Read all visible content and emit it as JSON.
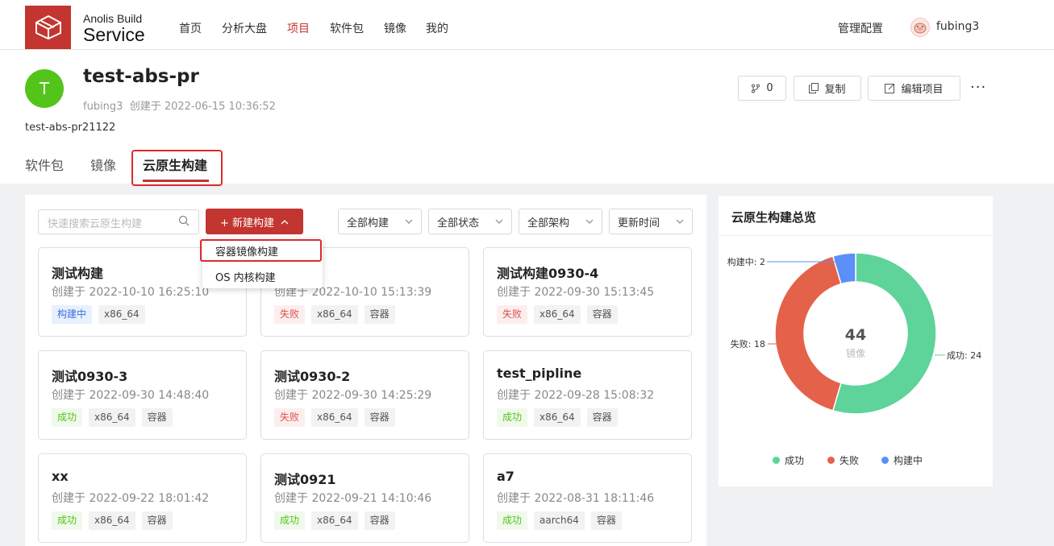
{
  "brand": {
    "line1": "Anolis Build",
    "line2": "Service"
  },
  "nav": [
    "首页",
    "分析大盘",
    "项目",
    "软件包",
    "镜像",
    "我的"
  ],
  "nav_active": "项目",
  "admin": "管理配置",
  "user": "fubing3",
  "project": {
    "avatar_letter": "T",
    "title": "test-abs-pr",
    "meta": "fubing3  创建于 2022-06-15 10:36:52",
    "desc": "test-abs-pr21122",
    "fork_count": "0",
    "copy_label": "复制",
    "edit_label": "编辑项目",
    "more": "···"
  },
  "tabs": [
    "软件包",
    "镜像",
    "云原生构建"
  ],
  "active_tab": "云原生构建",
  "toolbar": {
    "search_placeholder": "快速搜索云原生构建",
    "new_build": "+ 新建构建",
    "filters": [
      "全部构建",
      "全部状态",
      "全部架构",
      "更新时间"
    ]
  },
  "dropdown": [
    "容器镜像构建",
    "OS 内核构建"
  ],
  "cards": [
    {
      "title": "测试构建",
      "date": "创建于 2022-10-10 16:25:10",
      "tags": [
        {
          "t": "构建中",
          "k": "run"
        },
        {
          "t": "x86_64",
          "k": ""
        }
      ]
    },
    {
      "title": "",
      "date": "创建于 2022-10-10 15:13:39",
      "tags": [
        {
          "t": "失败",
          "k": "fail"
        },
        {
          "t": "x86_64",
          "k": ""
        },
        {
          "t": "容器",
          "k": ""
        }
      ]
    },
    {
      "title": "测试构建0930-4",
      "date": "创建于 2022-09-30 15:13:45",
      "tags": [
        {
          "t": "失败",
          "k": "fail"
        },
        {
          "t": "x86_64",
          "k": ""
        },
        {
          "t": "容器",
          "k": ""
        }
      ]
    },
    {
      "title": "测试0930-3",
      "date": "创建于 2022-09-30 14:48:40",
      "tags": [
        {
          "t": "成功",
          "k": "ok"
        },
        {
          "t": "x86_64",
          "k": ""
        },
        {
          "t": "容器",
          "k": ""
        }
      ]
    },
    {
      "title": "测试0930-2",
      "date": "创建于 2022-09-30 14:25:29",
      "tags": [
        {
          "t": "失败",
          "k": "fail"
        },
        {
          "t": "x86_64",
          "k": ""
        },
        {
          "t": "容器",
          "k": ""
        }
      ]
    },
    {
      "title": "test_pipline",
      "date": "创建于 2022-09-28 15:08:32",
      "tags": [
        {
          "t": "成功",
          "k": "ok"
        },
        {
          "t": "x86_64",
          "k": ""
        },
        {
          "t": "容器",
          "k": ""
        }
      ]
    },
    {
      "title": "xx",
      "date": "创建于 2022-09-22 18:01:42",
      "tags": [
        {
          "t": "成功",
          "k": "ok"
        },
        {
          "t": "x86_64",
          "k": ""
        },
        {
          "t": "容器",
          "k": ""
        }
      ]
    },
    {
      "title": "测试0921",
      "date": "创建于 2022-09-21 14:10:46",
      "tags": [
        {
          "t": "成功",
          "k": "ok"
        },
        {
          "t": "x86_64",
          "k": ""
        },
        {
          "t": "容器",
          "k": ""
        }
      ]
    },
    {
      "title": "a7",
      "date": "创建于 2022-08-31 18:11:46",
      "tags": [
        {
          "t": "成功",
          "k": "ok"
        },
        {
          "t": "aarch64",
          "k": ""
        },
        {
          "t": "容器",
          "k": ""
        }
      ]
    }
  ],
  "overview": {
    "title": "云原生构建总览",
    "total": "44",
    "total_label": "镜像"
  },
  "chart_data": {
    "type": "pie",
    "donut": true,
    "categories": [
      "成功",
      "失败",
      "构建中"
    ],
    "values": [
      24,
      18,
      2
    ],
    "colors": [
      "#5ed39a",
      "#e4624a",
      "#5b8ff9"
    ],
    "labels": [
      "成功: 24",
      "失败: 18",
      "构建中: 2"
    ],
    "center_value": "44",
    "center_label": "镜像",
    "legend_position": "bottom"
  },
  "colors": {
    "accent": "#c23531",
    "success": "#5ed39a",
    "fail": "#e4624a",
    "running": "#5b8ff9"
  }
}
